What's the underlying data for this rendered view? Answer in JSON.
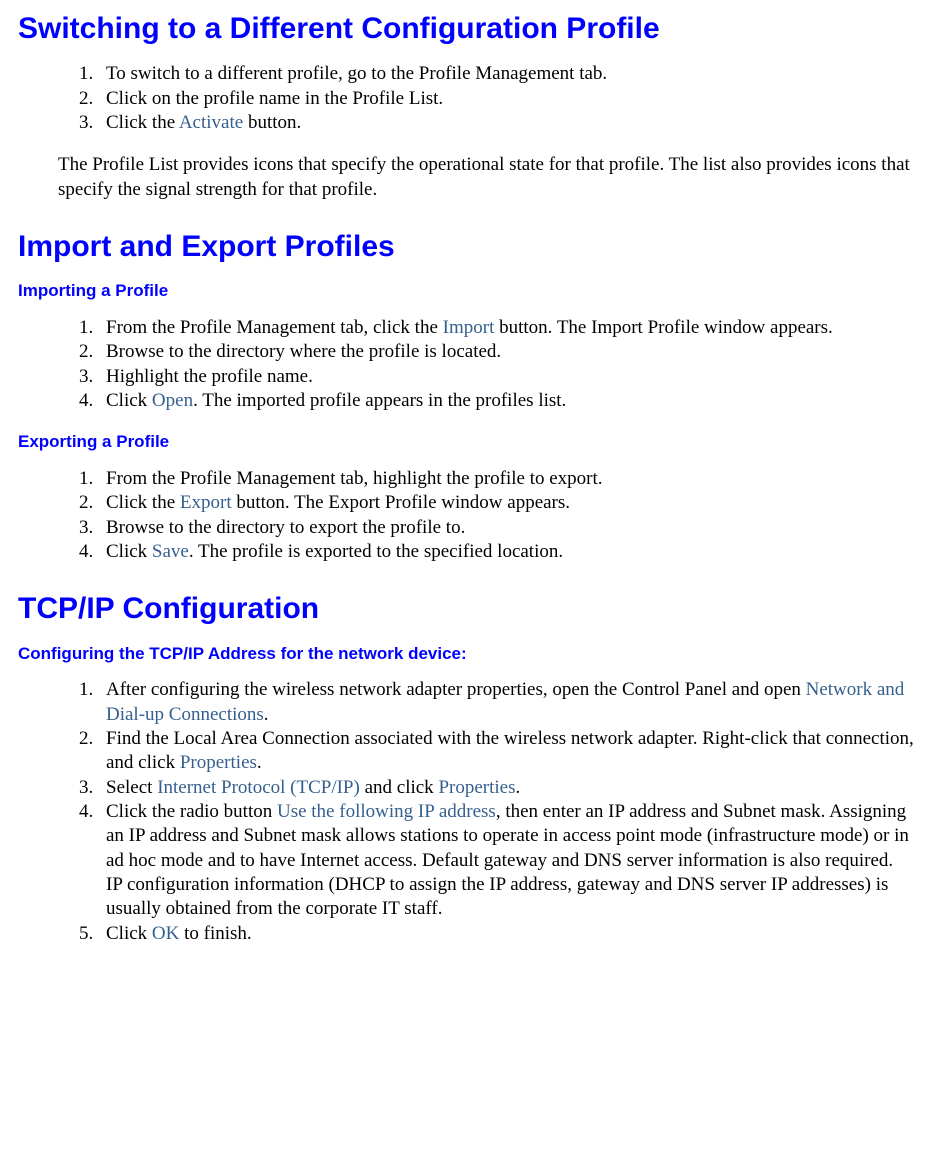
{
  "sec1": {
    "heading": "Switching to a Different Configuration Profile",
    "items": [
      {
        "pre": "To switch to a different profile, go to the Profile Management tab."
      },
      {
        "pre": "Click on the profile name in the Profile List."
      },
      {
        "pre": "Click the ",
        "term": "Activate",
        "post": " button."
      }
    ],
    "para": "The Profile List provides icons that specify the operational state for that profile. The list also provides icons that specify the signal strength for that profile."
  },
  "sec2": {
    "heading": "Import and Export Profiles",
    "sub1": "Importing a Profile",
    "importItems": [
      {
        "pre": "From the Profile Management tab, click the ",
        "term": "Import",
        "post": " button. The Import Profile window appears."
      },
      {
        "pre": "Browse to the directory where the profile is located."
      },
      {
        "pre": "Highlight the profile name."
      },
      {
        "pre": "Click ",
        "term": "Open",
        "post": ". The imported profile appears in the profiles list."
      }
    ],
    "sub2": "Exporting a Profile",
    "exportItems": [
      {
        "pre": "From the Profile Management tab, highlight the profile to export."
      },
      {
        "pre": "Click the ",
        "term": "Export",
        "post": " button. The Export Profile window appears."
      },
      {
        "pre": "Browse to the directory to export the profile to."
      },
      {
        "pre": "Click ",
        "term": "Save",
        "post": ". The profile is exported to the specified location."
      }
    ]
  },
  "sec3": {
    "heading": "TCP/IP Configuration",
    "sub": "Configuring the TCP/IP Address for the network device:",
    "items": [
      {
        "pre": "After configuring the wireless network adapter properties, open the Control Panel and open ",
        "term": "Network and Dial-up Connections",
        "post": "."
      },
      {
        "pre": "Find the Local Area Connection associated with the wireless network adapter. Right-click that connection, and click ",
        "term": "Properties",
        "post": "."
      },
      {
        "pre": "Select ",
        "term": "Internet Protocol (TCP/IP)",
        "mid": " and click ",
        "term2": "Properties",
        "post": "."
      },
      {
        "pre": "Click the radio button ",
        "term": "Use the following IP address",
        "post": ", then enter an IP address and Subnet mask. Assigning an IP address and Subnet mask allows stations to operate in access point mode (infrastructure mode) or in ad hoc mode and to have Internet access. Default gateway and DNS server information is also required.  IP configuration information (DHCP to assign the IP address, gateway and DNS server IP addresses) is usually obtained from the corporate IT staff."
      },
      {
        "pre": "Click ",
        "term": "OK",
        "post": " to finish."
      }
    ]
  }
}
